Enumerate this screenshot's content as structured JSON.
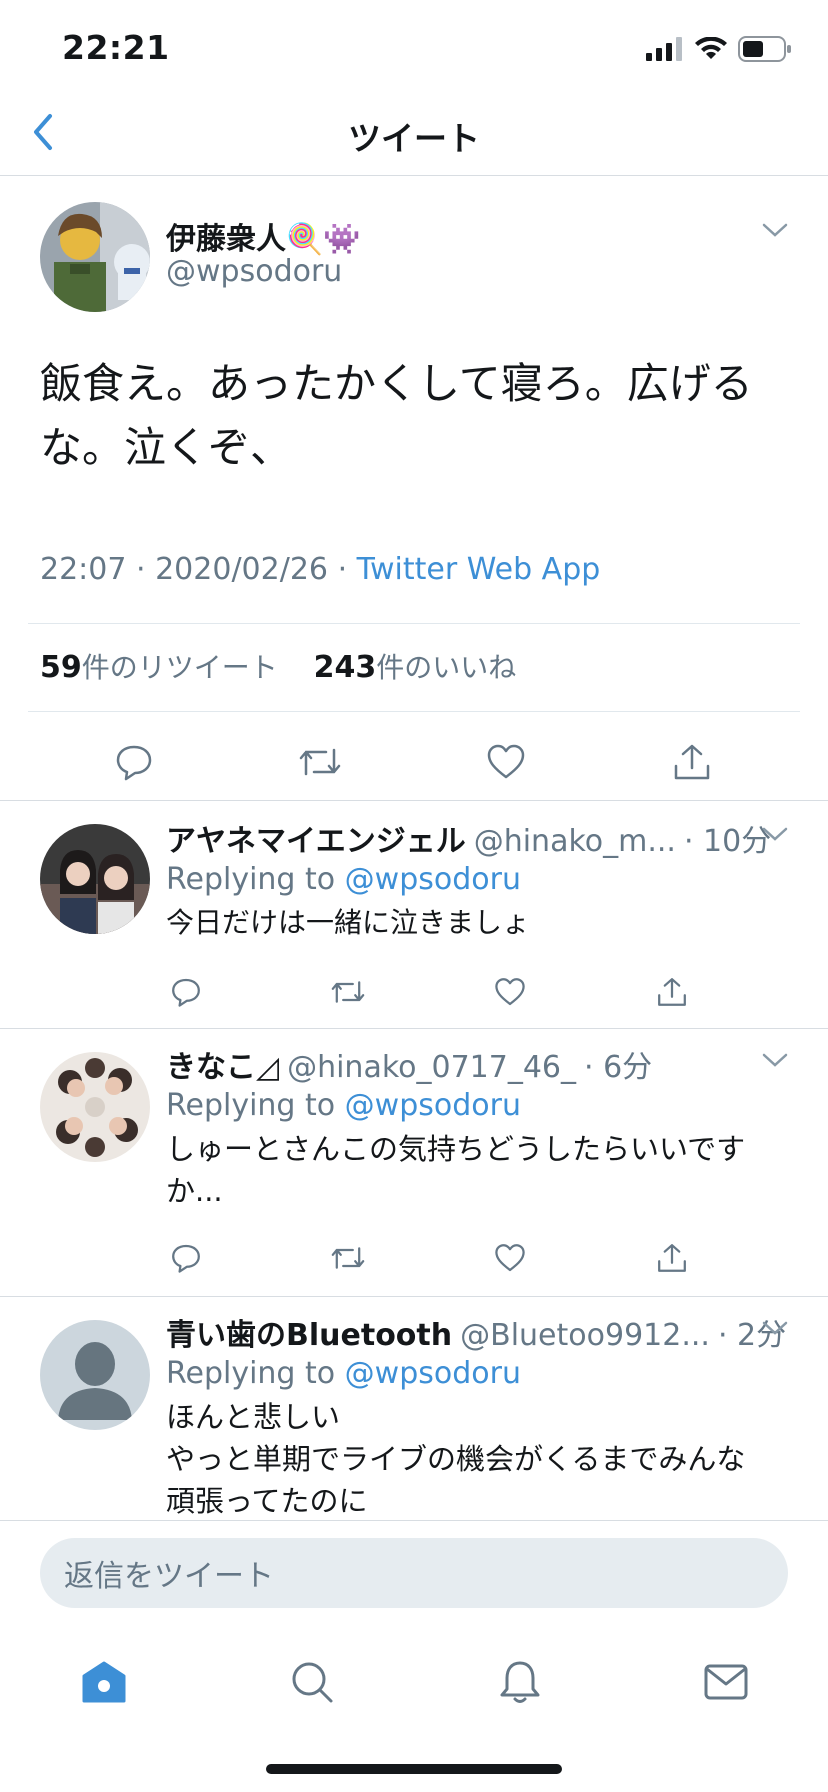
{
  "status_bar": {
    "time": "22:21"
  },
  "nav": {
    "title": "ツイート"
  },
  "tweet": {
    "name": "伊藤衆人🍭👾",
    "handle": "@wpsodoru",
    "text": "飯食え。あったかくして寝ろ。広げるな。泣くぞ、",
    "time": "22:07",
    "date": "2020/02/26",
    "source": "Twitter Web App",
    "retweets_count": "59",
    "retweets_label": "件のリツイート",
    "likes_count": "243",
    "likes_label": "件のいいね"
  },
  "replies": [
    {
      "name": "アヤネマイエンジェル",
      "handle": "@hinako_m...",
      "age": "· 10分",
      "replying_prefix": "Replying to ",
      "replying_to": "@wpsodoru",
      "text": "今日だけは一緒に泣きましょ"
    },
    {
      "name": "きなこ◿",
      "handle": "@hinako_0717_46_",
      "age": "· 6分",
      "replying_prefix": "Replying to ",
      "replying_to": "@wpsodoru",
      "text": "しゅーとさんこの気持ちどうしたらいいですか..."
    },
    {
      "name": "青い歯のBluetooth",
      "handle": "@Bluetoo9912...",
      "age": "· 2分",
      "replying_prefix": "Replying to ",
      "replying_to": "@wpsodoru",
      "text_line1": "ほんと悲しい",
      "text_line2": "やっと単期でライブの機会がくるまでみんな",
      "text_line3": "頑張ってたのに"
    }
  ],
  "composer": {
    "placeholder": "返信をツイート"
  },
  "colors": {
    "accent": "#3d8fd6",
    "secondary_text": "#657786",
    "primary_text": "#14171a"
  },
  "tabs": [
    "home-icon",
    "search-icon",
    "bell-icon",
    "mail-icon"
  ]
}
